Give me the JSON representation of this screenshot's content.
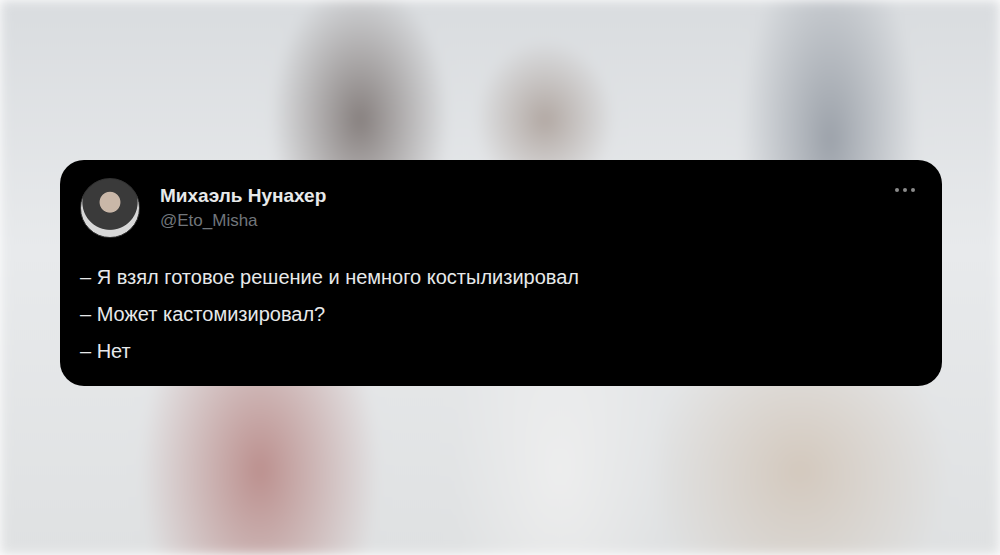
{
  "post": {
    "author": "Михаэль Нунахер",
    "handle": "@Eto_Misha",
    "lines": [
      "– Я взял готовое решение и немного костылизировал",
      "– Может кастомизировал?",
      "– Нет"
    ]
  }
}
